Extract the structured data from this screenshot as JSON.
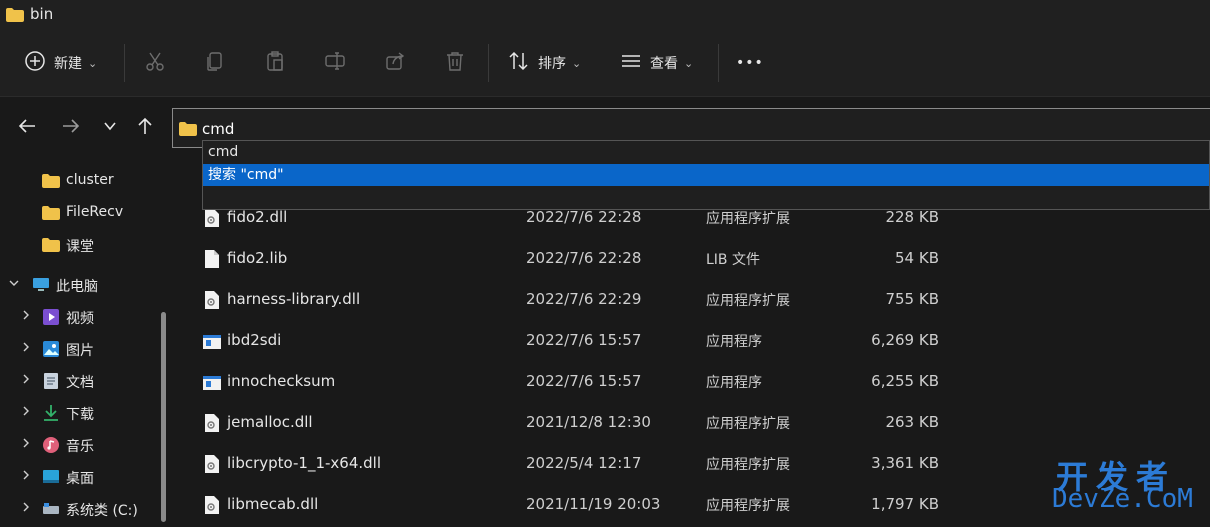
{
  "window": {
    "title": "bin"
  },
  "toolbar": {
    "new_label": "新建",
    "sort_label": "排序",
    "view_label": "查看",
    "more_label": "•••"
  },
  "address": {
    "value": "cmd",
    "suggestions": [
      {
        "label": "cmd",
        "selected": false
      },
      {
        "label": "搜索 \"cmd\"",
        "selected": true
      }
    ]
  },
  "sidebar": {
    "items": [
      {
        "label": "cluster",
        "icon": "folder-icon",
        "expandable": false,
        "expanded": false
      },
      {
        "label": "FileRecv",
        "icon": "folder-icon",
        "expandable": false,
        "expanded": false
      },
      {
        "label": "课堂",
        "icon": "folder-icon",
        "expandable": false,
        "expanded": false
      },
      {
        "label": "此电脑",
        "icon": "computer-icon",
        "expandable": true,
        "expanded": true
      },
      {
        "label": "视频",
        "icon": "video-icon",
        "expandable": true,
        "expanded": false
      },
      {
        "label": "图片",
        "icon": "pictures-icon",
        "expandable": true,
        "expanded": false
      },
      {
        "label": "文档",
        "icon": "documents-icon",
        "expandable": true,
        "expanded": false
      },
      {
        "label": "下载",
        "icon": "download-icon",
        "expandable": true,
        "expanded": false
      },
      {
        "label": "音乐",
        "icon": "music-icon",
        "expandable": true,
        "expanded": false
      },
      {
        "label": "桌面",
        "icon": "desktop-icon",
        "expandable": true,
        "expanded": false
      },
      {
        "label": "系统类 (C:)",
        "icon": "drive-icon",
        "expandable": true,
        "expanded": false
      }
    ]
  },
  "files": [
    {
      "name": "fido2.dll",
      "date": "2022/7/6 22:28",
      "type": "应用程序扩展",
      "size": "228 KB",
      "icon": "dll-icon"
    },
    {
      "name": "fido2.lib",
      "date": "2022/7/6 22:28",
      "type": "LIB 文件",
      "size": "54 KB",
      "icon": "file-icon"
    },
    {
      "name": "harness-library.dll",
      "date": "2022/7/6 22:29",
      "type": "应用程序扩展",
      "size": "755 KB",
      "icon": "dll-icon"
    },
    {
      "name": "ibd2sdi",
      "date": "2022/7/6 15:57",
      "type": "应用程序",
      "size": "6,269 KB",
      "icon": "exe-icon"
    },
    {
      "name": "innochecksum",
      "date": "2022/7/6 15:57",
      "type": "应用程序",
      "size": "6,255 KB",
      "icon": "exe-icon"
    },
    {
      "name": "jemalloc.dll",
      "date": "2021/12/8 12:30",
      "type": "应用程序扩展",
      "size": "263 KB",
      "icon": "dll-icon"
    },
    {
      "name": "libcrypto-1_1-x64.dll",
      "date": "2022/5/4 12:17",
      "type": "应用程序扩展",
      "size": "3,361 KB",
      "icon": "dll-icon"
    },
    {
      "name": "libmecab.dll",
      "date": "2021/11/19 20:03",
      "type": "应用程序扩展",
      "size": "1,797 KB",
      "icon": "dll-icon"
    }
  ],
  "watermark": {
    "line1": "开发者",
    "line2": "DevZe.CoM"
  },
  "colors": {
    "accent": "#0a66c9",
    "folder": "#f0c24a",
    "background": "#191919"
  }
}
